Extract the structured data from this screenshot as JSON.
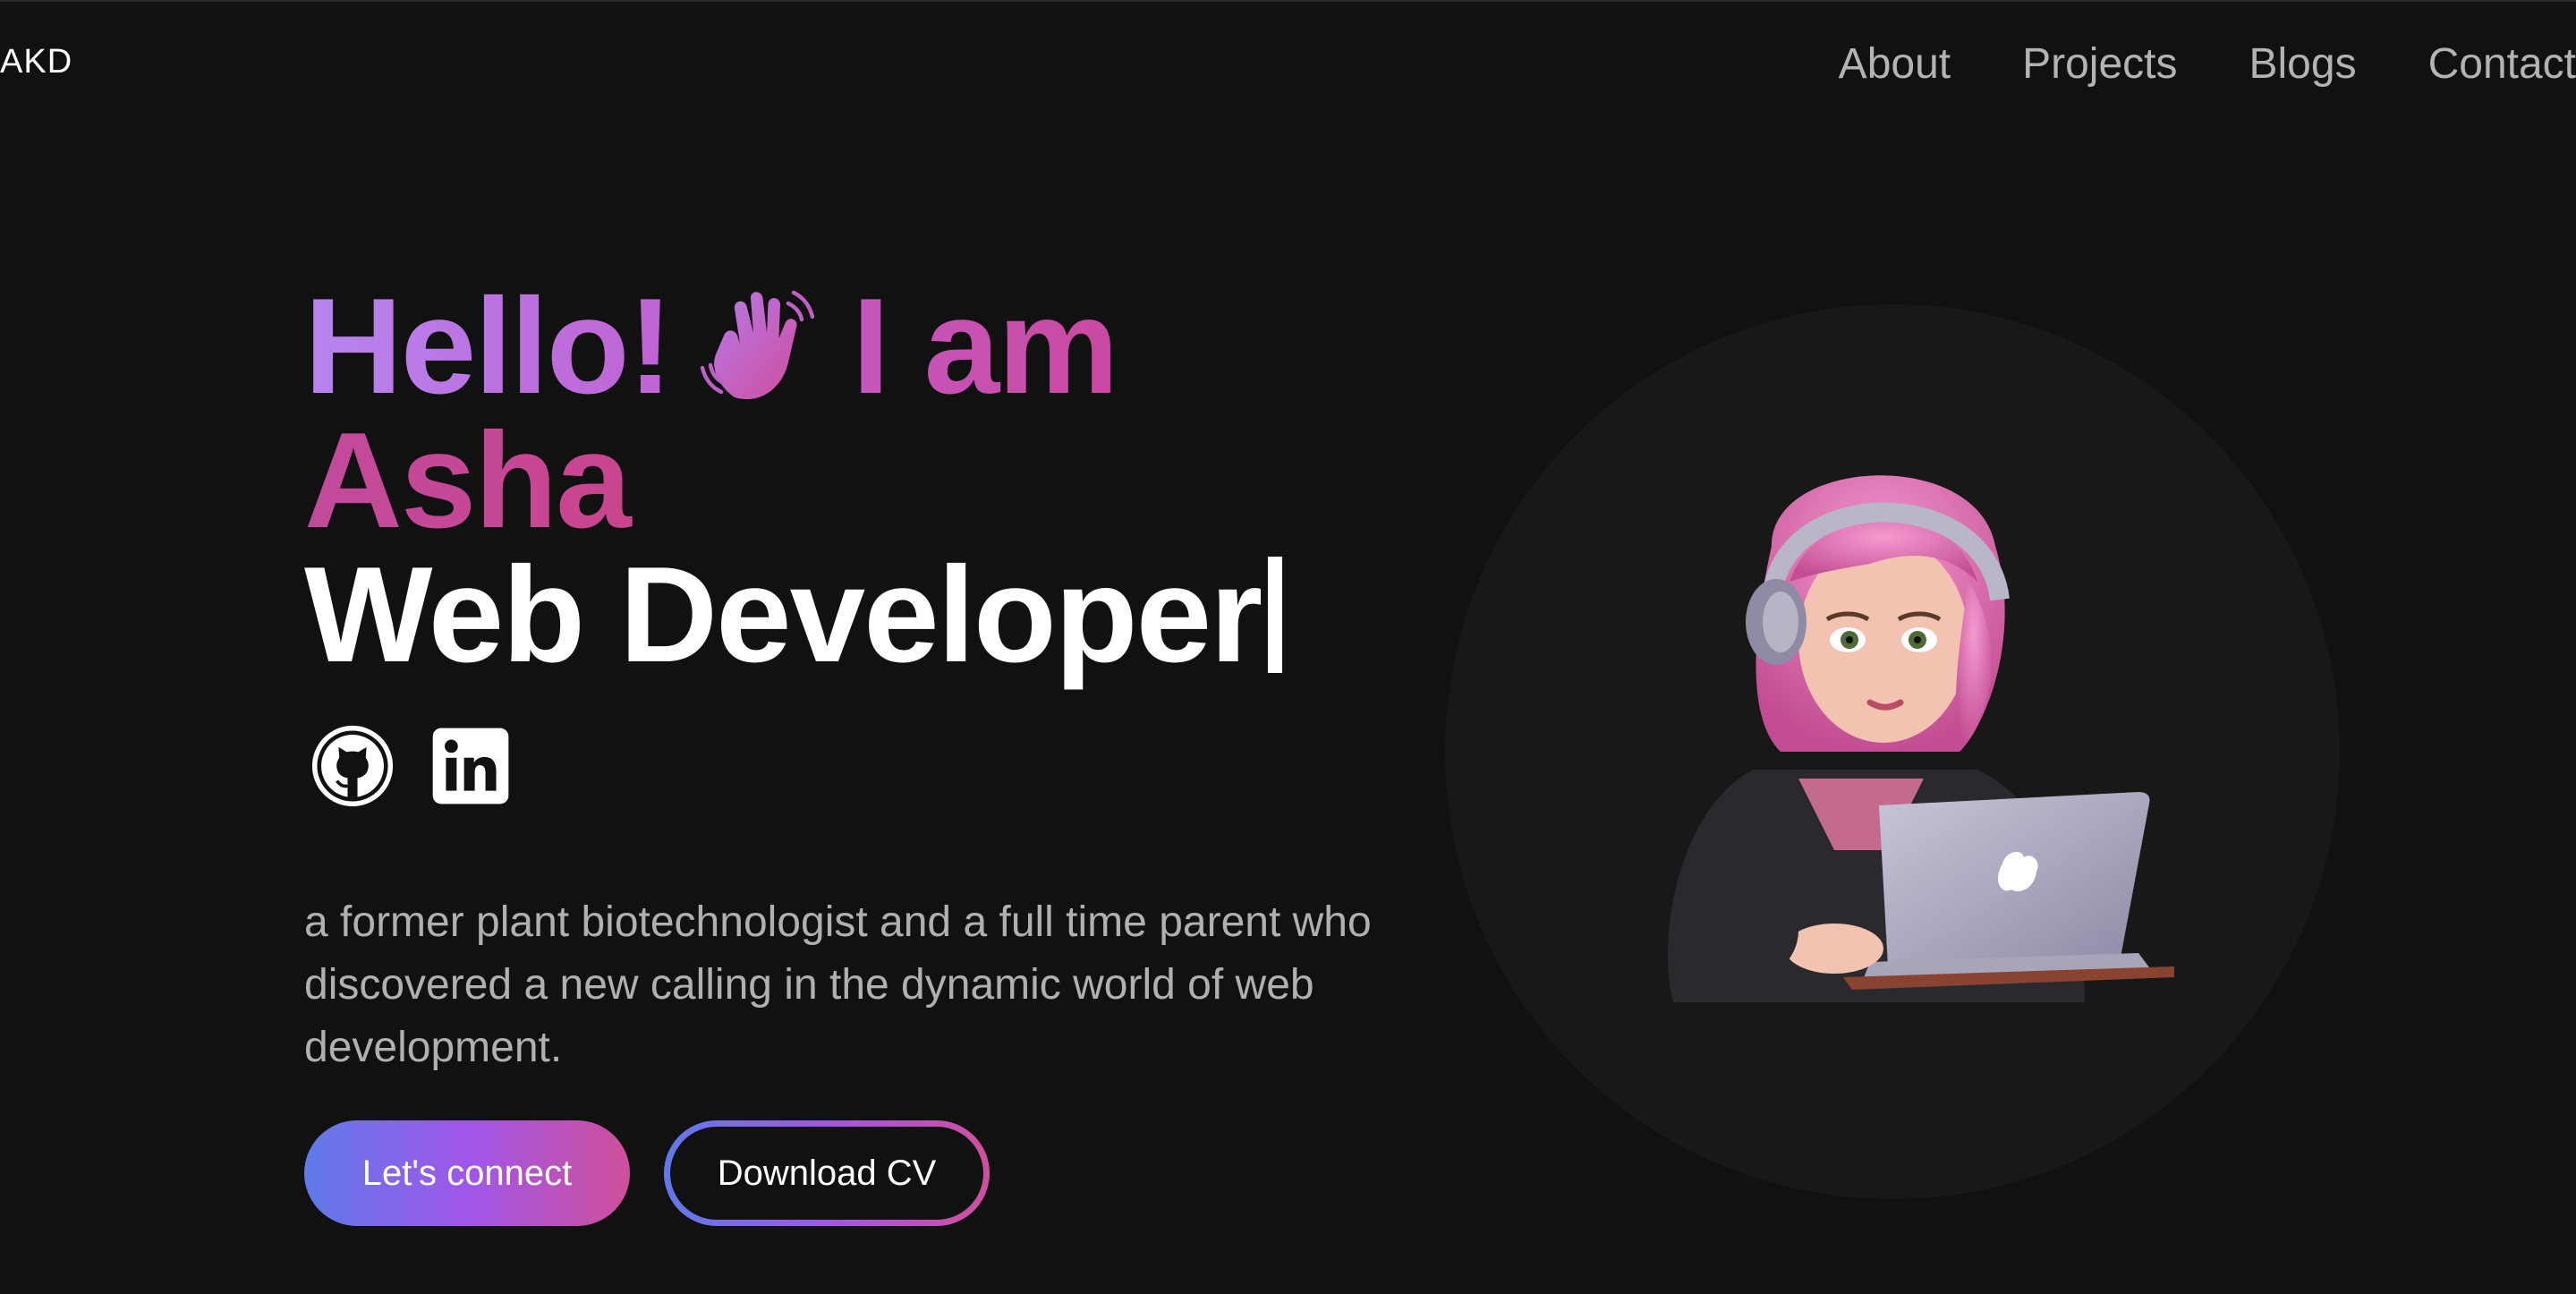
{
  "header": {
    "logo": "AKD",
    "nav": [
      "About",
      "Projects",
      "Blogs",
      "Contact"
    ]
  },
  "hero": {
    "greeting": "Hello!",
    "greeting_suffix": "I am",
    "name": "Asha",
    "role": "Web Developer",
    "bio": "a former plant biotechnologist and a full time parent who discovered a new calling in the dynamic world of web development.",
    "primary_button": "Let's connect",
    "secondary_button": "Download CV"
  },
  "icons": {
    "wave": "waving-hand-icon",
    "github": "github-icon",
    "linkedin": "linkedin-icon",
    "avatar": "avatar-illustration"
  },
  "colors": {
    "background": "#111111",
    "gradient_start": "#5f7ae8",
    "gradient_mid": "#a057e9",
    "gradient_end": "#cf4f9a",
    "name_pink": "#d73c72"
  }
}
